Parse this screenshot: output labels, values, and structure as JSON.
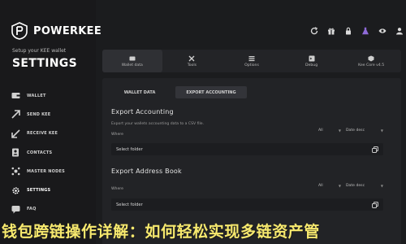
{
  "brand": {
    "name": "POWERKEE"
  },
  "sidebar": {
    "setup_text": "Setup your KEE wallet",
    "title": "SETTINGS",
    "items": [
      {
        "label": "WALLET",
        "icon": "wallet-icon"
      },
      {
        "label": "SEND KEE",
        "icon": "send-arrow-icon"
      },
      {
        "label": "RECEIVE KEE",
        "icon": "receive-arrow-icon"
      },
      {
        "label": "CONTACTS",
        "icon": "contacts-icon"
      },
      {
        "label": "MASTER NODES",
        "icon": "masternodes-icon"
      },
      {
        "label": "SETTINGS",
        "icon": "gear-icon",
        "active": true
      },
      {
        "label": "FAQ",
        "icon": "faq-icon"
      }
    ]
  },
  "toolbar": [
    "refresh-icon",
    "gift-icon",
    "lock-icon",
    "flask-icon",
    "eye-icon",
    "user-icon"
  ],
  "tabs": [
    {
      "label": "Wallet data",
      "icon": "wallet-data-icon",
      "active": true
    },
    {
      "label": "Tools",
      "icon": "tools-icon"
    },
    {
      "label": "Options",
      "icon": "options-icon"
    },
    {
      "label": "Debug",
      "icon": "debug-icon"
    },
    {
      "label": "Kee Core v4.5",
      "icon": "core-icon"
    }
  ],
  "subtabs": [
    {
      "label": "WALLET DATA"
    },
    {
      "label": "EXPORT ACCOUNTING",
      "active": true
    }
  ],
  "export_accounting": {
    "title": "Export Accounting",
    "description": "Export your wallets accounting data to a CSV file.",
    "where_label": "Where",
    "filter": "All",
    "sort": "Date desc",
    "folder_placeholder": "Select folder"
  },
  "export_address_book": {
    "title": "Export Address Book",
    "where_label": "Where",
    "filter": "All",
    "sort": "Date desc",
    "folder_placeholder": "Select folder"
  },
  "caption": "钱包跨链操作详解：如何轻松实现多链资产管",
  "colors": {
    "accent": "#ffffff",
    "caption": "#f7e96e",
    "panel": "#222326"
  }
}
